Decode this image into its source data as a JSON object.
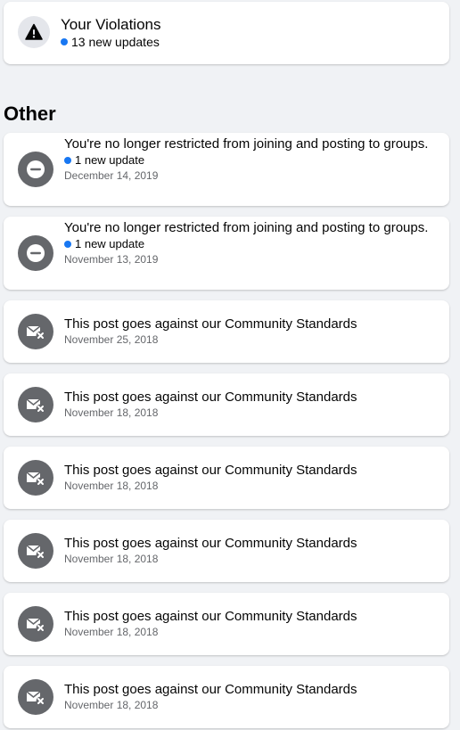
{
  "violations": {
    "title": "Your Violations",
    "updates": "13 new updates",
    "icon": "warning-icon"
  },
  "section_heading": "Other",
  "items": [
    {
      "title": "You're no longer restricted from joining and posting to groups.",
      "update": "1 new update",
      "date": "December 14, 2019",
      "icon": "minus-circle-icon"
    },
    {
      "title": "You're no longer restricted from joining and posting to groups.",
      "update": "1 new update",
      "date": "November 13, 2019",
      "icon": "minus-circle-icon"
    },
    {
      "title": "This post goes against our Community Standards",
      "date": "November 25, 2018",
      "icon": "removed-post-icon"
    },
    {
      "title": "This post goes against our Community Standards",
      "date": "November 18, 2018",
      "icon": "removed-post-icon"
    },
    {
      "title": "This post goes against our Community Standards",
      "date": "November 18, 2018",
      "icon": "removed-post-icon"
    },
    {
      "title": "This post goes against our Community Standards",
      "date": "November 18, 2018",
      "icon": "removed-post-icon"
    },
    {
      "title": "This post goes against our Community Standards",
      "date": "November 18, 2018",
      "icon": "removed-post-icon"
    },
    {
      "title": "This post goes against our Community Standards",
      "date": "November 18, 2018",
      "icon": "removed-post-icon"
    }
  ],
  "colors": {
    "background": "#f0f2f5",
    "card": "#ffffff",
    "unread_dot": "#1877f2",
    "icon_dark": "#65676b",
    "secondary_text": "#65676b"
  }
}
